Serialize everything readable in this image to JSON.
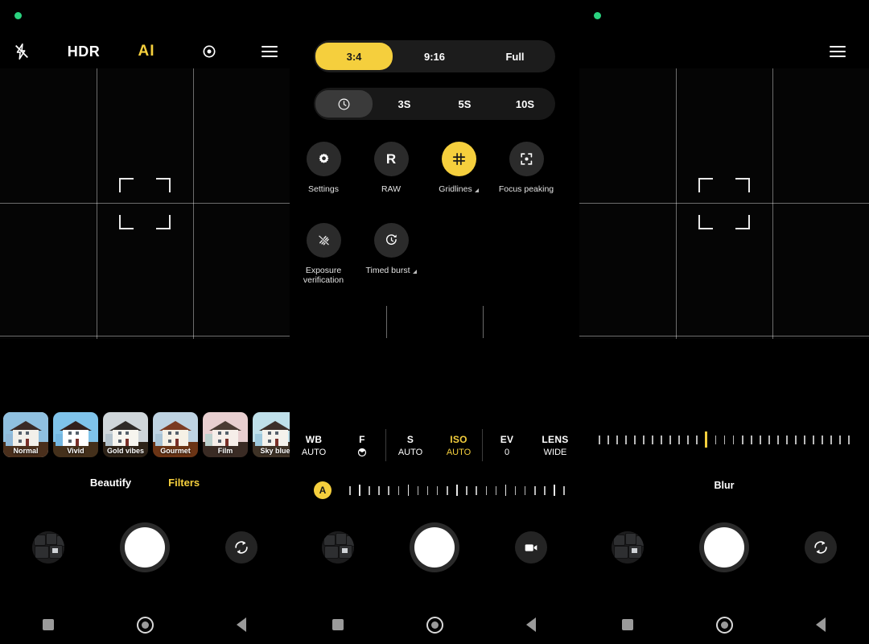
{
  "app": {
    "title": "Camera",
    "accent": "#f5cf3d",
    "background": "#000000",
    "status_dot_color": "#2ad27f"
  },
  "panels": [
    {
      "id": "filters-panel",
      "topbar": [
        {
          "name": "flash-off-icon",
          "label": "",
          "icon": "flash-off-icon",
          "active": false
        },
        {
          "name": "hdr-toggle",
          "label": "HDR",
          "icon": "",
          "active": false
        },
        {
          "name": "ai-toggle",
          "label": "AI",
          "icon": "",
          "active": true
        },
        {
          "name": "scene-detect-icon",
          "label": "",
          "icon": "scan-focus-icon",
          "active": false
        },
        {
          "name": "menu-button",
          "label": "",
          "icon": "hamburger-icon",
          "active": false
        }
      ],
      "filters": [
        {
          "label": "Normal",
          "selected": true,
          "sky": "#8fc0e0",
          "ground": "#4a2f1c",
          "house": "#f2f0ea",
          "roof": "#3a2a26",
          "wing": "#8fb8d8"
        },
        {
          "label": "Vivid",
          "selected": false,
          "sky": "#7fc3ea",
          "ground": "#44301b",
          "house": "#ffffff",
          "roof": "#32201c",
          "wing": "#73b7e2"
        },
        {
          "label": "Gold vibes",
          "selected": false,
          "sky": "#cfd6da",
          "ground": "#2e2318",
          "house": "#f7f5ef",
          "roof": "#2f2b28",
          "wing": "#b3c2cc"
        },
        {
          "label": "Gourmet",
          "selected": false,
          "sky": "#bed3e2",
          "ground": "#6b3415",
          "house": "#f6f1e6",
          "roof": "#7b3b22",
          "wing": "#a9c4d6"
        },
        {
          "label": "Film",
          "selected": false,
          "sky": "#e8cfd0",
          "ground": "#3a2b24",
          "house": "#f6eee9",
          "roof": "#4a3b33",
          "wing": "#bcd0cd"
        },
        {
          "label": "Sky blue",
          "selected": false,
          "sky": "#bfe0ea",
          "ground": "#3e3226",
          "house": "#f4f2ec",
          "roof": "#3c2f2a",
          "wing": "#9ec9dd"
        }
      ],
      "mode_tabs": [
        {
          "label": "Beautify",
          "active": false
        },
        {
          "label": "Filters",
          "active": true
        }
      ],
      "shutter_row": {
        "gallery": "gallery-thumbnail",
        "shutter": "shutter-button",
        "right_action": "switch-camera-icon"
      }
    },
    {
      "id": "settings-panel",
      "aspect_ratio": {
        "options": [
          "3:4",
          "9:16",
          "Full"
        ],
        "selected": "3:4"
      },
      "timer": {
        "options": [
          "timer-icon",
          "3S",
          "5S",
          "10S"
        ],
        "selected": "timer-icon"
      },
      "tiles": [
        {
          "label": "Settings",
          "icon": "gear-icon",
          "active": false,
          "expandable": false
        },
        {
          "label": "RAW",
          "icon": "raw-icon",
          "active": false,
          "expandable": false
        },
        {
          "label": "Gridlines",
          "icon": "grid-icon",
          "active": true,
          "expandable": true
        },
        {
          "label": "Focus peaking",
          "icon": "focus-peaking-icon",
          "active": false,
          "expandable": false
        },
        {
          "label": "Exposure verification",
          "icon": "exposure-stripes-icon",
          "active": false,
          "expandable": false
        },
        {
          "label": "Timed burst",
          "icon": "timed-burst-icon",
          "active": false,
          "expandable": true
        }
      ],
      "pro_controls": [
        {
          "key": "WB",
          "value": "AUTO",
          "selected": false,
          "divider": false
        },
        {
          "key": "F",
          "value": "aperture-icon",
          "selected": false,
          "divider": true
        },
        {
          "key": "S",
          "value": "AUTO",
          "selected": false,
          "divider": false
        },
        {
          "key": "ISO",
          "value": "AUTO",
          "selected": true,
          "divider": true
        },
        {
          "key": "EV",
          "value": "0",
          "selected": false,
          "divider": false
        },
        {
          "key": "LENS",
          "value": "WIDE",
          "selected": false,
          "divider": false
        }
      ],
      "exposure_badge": "A",
      "shutter_row": {
        "gallery": "gallery-thumbnail",
        "shutter": "shutter-button",
        "right_action": "video-mode-icon"
      }
    },
    {
      "id": "blur-panel",
      "topbar": [
        {
          "name": "menu-button",
          "label": "",
          "icon": "hamburger-icon",
          "active": false
        }
      ],
      "slider": {
        "label": "Blur",
        "ticks": 29,
        "current_index": 12
      },
      "shutter_row": {
        "gallery": "gallery-thumbnail",
        "shutter": "shutter-button",
        "right_action": "switch-camera-icon"
      }
    }
  ],
  "navbar": {
    "items": [
      {
        "name": "recents-button",
        "icon": "square-icon"
      },
      {
        "name": "home-button",
        "icon": "circle-icon"
      },
      {
        "name": "back-button",
        "icon": "triangle-left-icon"
      }
    ]
  }
}
